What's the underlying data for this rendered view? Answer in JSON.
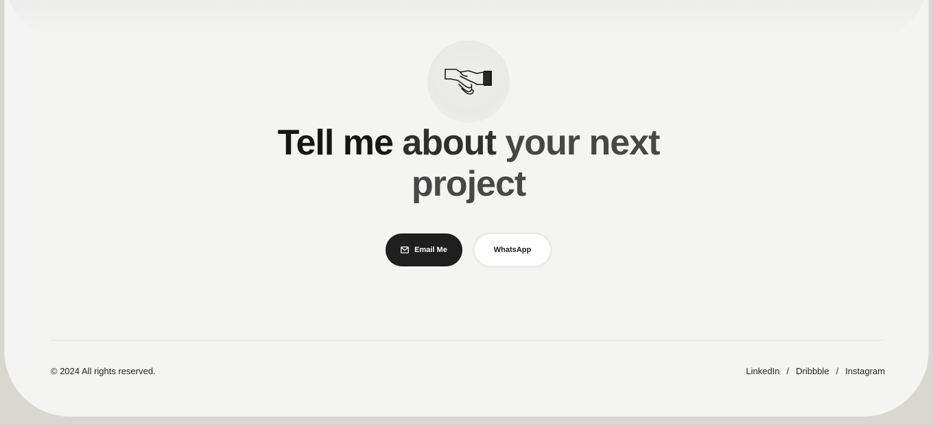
{
  "hero": {
    "icon": "handshake-icon",
    "headline_part1": "Tell me",
    "headline_part2": "about",
    "headline_part3": "your next",
    "headline_part4": "project"
  },
  "buttons": {
    "email_label": "Email Me",
    "email_icon": "mail-icon",
    "whatsapp_label": "WhatsApp"
  },
  "footer": {
    "copyright": "© 2024 All rights reserved.",
    "links": [
      "LinkedIn",
      "Dribbble",
      "Instagram"
    ],
    "separator": "/"
  },
  "colors": {
    "page_bg": "#d8d7d1",
    "card_bg": "#f4f4f3",
    "primary_button": "#1f1f1f",
    "text_dark": "#161616"
  }
}
